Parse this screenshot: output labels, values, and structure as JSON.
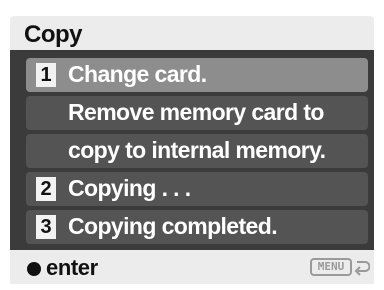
{
  "screen": {
    "title": "Copy",
    "steps": [
      {
        "number": "1",
        "label": "Change card."
      },
      {
        "number": "",
        "label": "Remove memory card to"
      },
      {
        "number": "",
        "label": "copy to internal memory."
      },
      {
        "number": "2",
        "label": "Copying . . ."
      },
      {
        "number": "3",
        "label": "Copying completed."
      }
    ]
  },
  "footer": {
    "enter_label": "enter",
    "menu_label": "MENU"
  },
  "colors": {
    "panel": "#3b3b3b",
    "selected_row": "#8d8d8d",
    "row": "#545454",
    "bars": "#ececec"
  },
  "icons": {
    "enter": "filled-circle-icon",
    "return": "return-arrow-icon"
  }
}
